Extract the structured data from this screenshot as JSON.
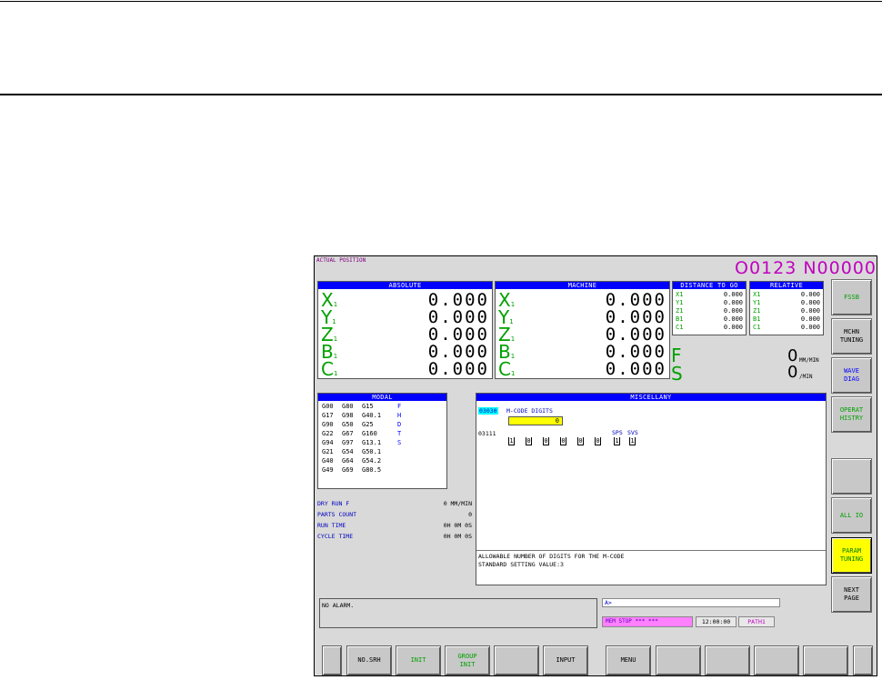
{
  "screen": {
    "title": "ACTUAL POSITION",
    "program_sequence": "O0123 N00000"
  },
  "absolute": {
    "header": "ABSOLUTE",
    "axes": [
      {
        "name": "X",
        "sub": "1",
        "value": "0.000"
      },
      {
        "name": "Y",
        "sub": "1",
        "value": "0.000"
      },
      {
        "name": "Z",
        "sub": "1",
        "value": "0.000"
      },
      {
        "name": "B",
        "sub": "1",
        "value": "0.000"
      },
      {
        "name": "C",
        "sub": "1",
        "value": "0.000"
      }
    ]
  },
  "machine": {
    "header": "MACHINE",
    "axes": [
      {
        "name": "X",
        "sub": "1",
        "value": "0.000"
      },
      {
        "name": "Y",
        "sub": "1",
        "value": "0.000"
      },
      {
        "name": "Z",
        "sub": "1",
        "value": "0.000"
      },
      {
        "name": "B",
        "sub": "1",
        "value": "0.000"
      },
      {
        "name": "C",
        "sub": "1",
        "value": "0.000"
      }
    ]
  },
  "distance_to_go": {
    "header": "DISTANCE TO GO",
    "axes": [
      {
        "name": "X1",
        "value": "0.000"
      },
      {
        "name": "Y1",
        "value": "0.000"
      },
      {
        "name": "Z1",
        "value": "0.000"
      },
      {
        "name": "B1",
        "value": "0.000"
      },
      {
        "name": "C1",
        "value": "0.000"
      }
    ]
  },
  "relative": {
    "header": "RELATIVE",
    "axes": [
      {
        "name": "X1",
        "value": "0.000"
      },
      {
        "name": "Y1",
        "value": "0.000"
      },
      {
        "name": "Z1",
        "value": "0.000"
      },
      {
        "name": "B1",
        "value": "0.000"
      },
      {
        "name": "C1",
        "value": "0.000"
      }
    ]
  },
  "feed": {
    "letter": "F",
    "value": "0",
    "unit": "MM/MIN"
  },
  "spindle": {
    "letter": "S",
    "value": "0",
    "unit": "/MIN"
  },
  "modal": {
    "header": "MODAL",
    "rows": [
      [
        "G00",
        "G80",
        "G15"
      ],
      [
        "G17",
        "G98",
        "G40.1"
      ],
      [
        "G90",
        "G50",
        "G25"
      ],
      [
        "G22",
        "G67",
        "G160"
      ],
      [
        "G94",
        "G97",
        "G13.1"
      ],
      [
        "G21",
        "G54",
        "G50.1"
      ],
      [
        "G40",
        "G64",
        "G54.2"
      ],
      [
        "G49",
        "G69",
        "G80.5"
      ]
    ],
    "letters": [
      "F",
      "H",
      "D",
      "T",
      "S"
    ]
  },
  "info": {
    "dry_run_label": "DRY RUN F",
    "dry_run_value": "0 MM/MIN",
    "parts_count_label": "PARTS COUNT",
    "parts_count_value": "0",
    "run_time_label": "RUN TIME",
    "run_time_value": "0H 0M 0S",
    "cycle_time_label": "CYCLE TIME",
    "cycle_time_value": "0H 0M 0S"
  },
  "misc": {
    "header": "MISCELLANY",
    "param1_no": "03030",
    "param1_name": "M-CODE DIGITS",
    "param1_value": "0",
    "param2_no": "03111",
    "param2_bit_labels": {
      "sps": "SPS",
      "svs": "SVS"
    },
    "param2_bits": [
      "1",
      "0",
      "0",
      "0",
      "0",
      "0",
      "1",
      "1"
    ],
    "description_line1": "ALLOWABLE NUMBER OF DIGITS FOR THE M-CODE",
    "description_line2": "STANDARD SETTING VALUE:3"
  },
  "alarm": {
    "message": "NO ALARM."
  },
  "input_line": {
    "prompt": "A>"
  },
  "status": {
    "mode": "MEM",
    "state": "STOP",
    "motion": "***",
    "extra": "***",
    "time": "12:00:00",
    "path": "PATH1"
  },
  "right_keys": [
    {
      "label": "FSSB"
    },
    {
      "label": "MCHN\nTUNING"
    },
    {
      "label": "WAVE\nDIAG"
    },
    {
      "label": "OPERAT\nHISTRY"
    },
    {
      "label": ""
    },
    {
      "label": "ALL IO"
    },
    {
      "label": "PARAM\nTUNING"
    },
    {
      "label": "NEXT\nPAGE"
    }
  ],
  "bottom_keys": [
    {
      "label": ""
    },
    {
      "label": "NO.SRH"
    },
    {
      "label": "INIT"
    },
    {
      "label": "GROUP\nINIT"
    },
    {
      "label": ""
    },
    {
      "label": "INPUT"
    },
    {
      "label": "MENU"
    },
    {
      "label": ""
    },
    {
      "label": ""
    },
    {
      "label": ""
    },
    {
      "label": ""
    },
    {
      "label": ""
    }
  ]
}
